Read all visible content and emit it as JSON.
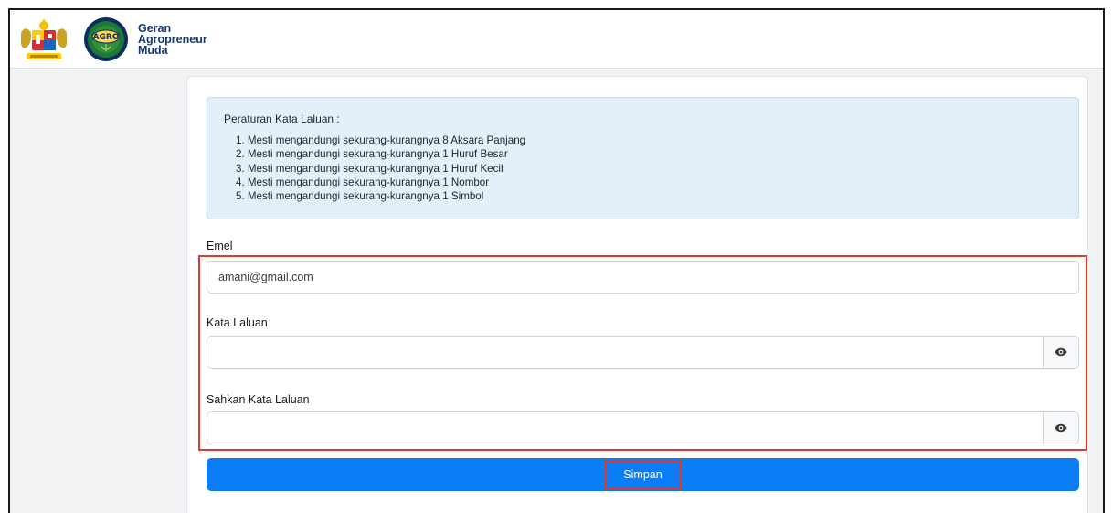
{
  "header": {
    "brand_line1": "Geran",
    "brand_line2": "Agropreneur",
    "brand_line3": "Muda",
    "logo_left_icon": "malaysia-coat-of-arms-icon",
    "logo_right_icon": "agro-logo-icon",
    "logo_right_text": "AGRO"
  },
  "rules": {
    "title": "Peraturan Kata Laluan :",
    "items": [
      "1. Mesti mengandungi sekurang-kurangnya 8 Aksara Panjang",
      "2. Mesti mengandungi sekurang-kurangnya 1 Huruf Besar",
      "3. Mesti mengandungi sekurang-kurangnya 1 Huruf Kecil",
      "4. Mesti mengandungi sekurang-kurangnya 1 Nombor",
      "5. Mesti mengandungi sekurang-kurangnya 1 Simbol"
    ]
  },
  "form": {
    "email_label": "Emel",
    "email_value": "amani@gmail.com",
    "password_label": "Kata Laluan",
    "password_value": "",
    "confirm_label": "Sahkan Kata Laluan",
    "confirm_value": "",
    "toggle_icon": "eye-icon",
    "submit_label": "Simpan"
  },
  "colors": {
    "primary": "#0b7ef5",
    "info_bg": "#e4effa",
    "highlight": "#e03a2f",
    "brand_text": "#163a70"
  }
}
